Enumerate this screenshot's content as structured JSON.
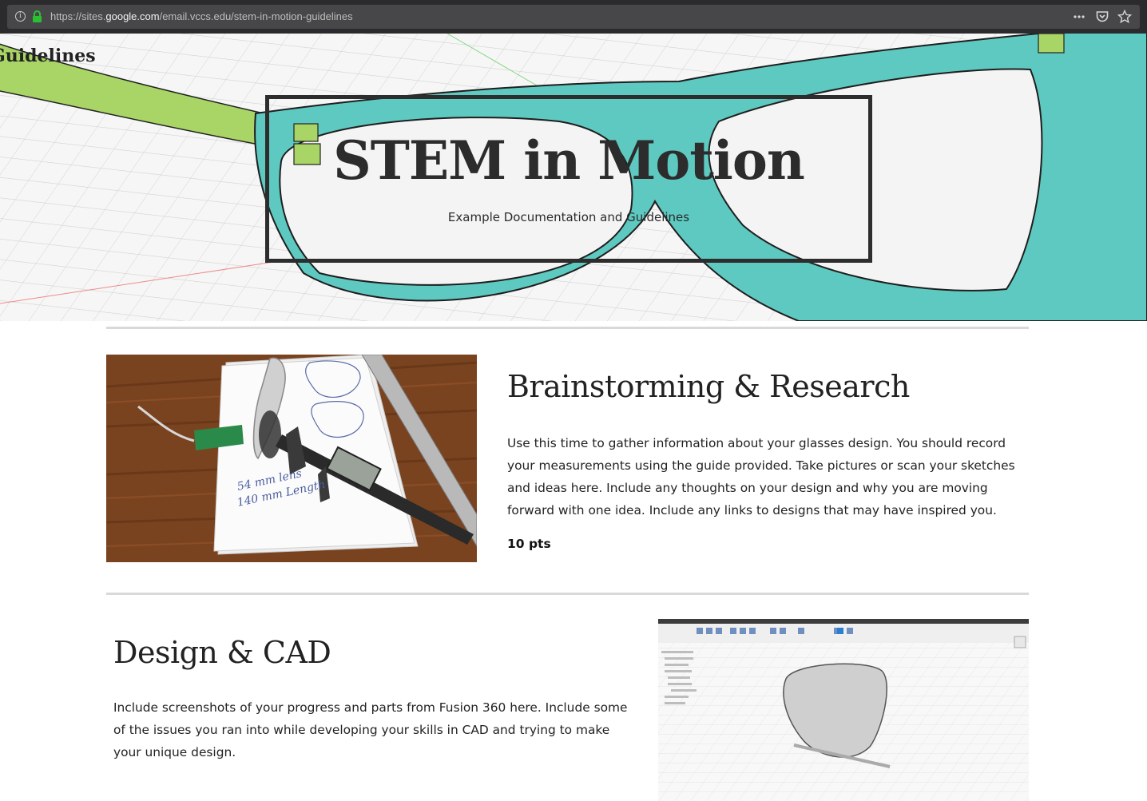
{
  "browser": {
    "url_prefix": "https://sites.",
    "url_domain": "google.com",
    "url_path": "/email.vccs.edu/stem-in-motion-guidelines",
    "info_icon": "info-icon",
    "lock_icon": "lock-icon",
    "menu_icon": "more-dots-icon",
    "pocket_icon": "pocket-icon",
    "bookmark_icon": "star-icon"
  },
  "hero": {
    "corner_title": "Guidelines",
    "title": "STEM in Motion",
    "subtitle": "Example Documentation and Guidelines"
  },
  "sections": [
    {
      "heading": "Brainstorming & Research",
      "body": "Use this time to gather information about your glasses design. You should record your measurements using the guide provided. Take pictures or scan your sketches and ideas here. Include any thoughts on your design and why you are moving forward with one idea. Include any links to designs that may have inspired you.",
      "points": "10 pts",
      "photo_notes": [
        "54 mm lens",
        "140 mm Length"
      ]
    },
    {
      "heading": "Design & CAD",
      "body": "Include screenshots of your progress and parts from Fusion 360 here. Include some of the issues you ran into while developing your skills in CAD and trying to make your unique design."
    }
  ],
  "colors": {
    "frame_teal": "#5ec9c1",
    "temple_green": "#a9d466",
    "grid": "#cfcfcf",
    "divider": "#d9d9d9",
    "wood": "#7a4320"
  }
}
